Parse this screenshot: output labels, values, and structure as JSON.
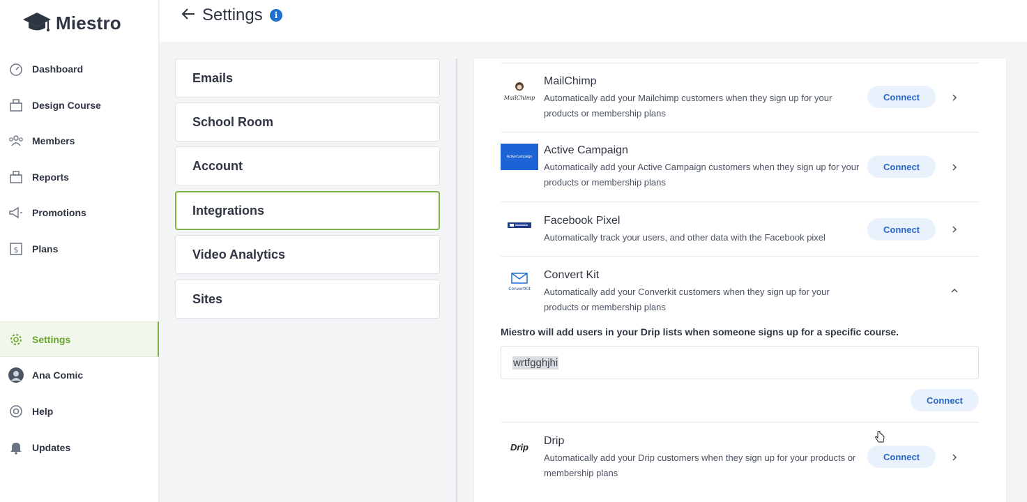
{
  "app": {
    "name": "Miestro"
  },
  "sidebar": {
    "items": [
      {
        "label": "Dashboard",
        "icon": "gauge-icon"
      },
      {
        "label": "Design Course",
        "icon": "box-icon"
      },
      {
        "label": "Members",
        "icon": "members-icon"
      },
      {
        "label": "Reports",
        "icon": "box-icon"
      },
      {
        "label": "Promotions",
        "icon": "megaphone-icon"
      },
      {
        "label": "Plans",
        "icon": "dollar-doc-icon"
      }
    ],
    "bottom_items": [
      {
        "label": "Settings",
        "icon": "gear-icon",
        "active": true
      },
      {
        "label": "Ana Comic",
        "icon": "avatar"
      },
      {
        "label": "Help",
        "icon": "lifebuoy-icon"
      },
      {
        "label": "Updates",
        "icon": "bell-icon"
      }
    ]
  },
  "header": {
    "title": "Settings",
    "info": "i"
  },
  "settings_menu": {
    "items": [
      "Emails",
      "School Room",
      "Account",
      "Integrations",
      "Video Analytics",
      "Sites"
    ],
    "active": "Integrations"
  },
  "integrations": {
    "items": [
      {
        "name": "MailChimp",
        "logo_text": "MailChimp",
        "desc": "Automatically add your Mailchimp customers when they sign up for your products or membership plans",
        "button": "Connect",
        "expanded": false
      },
      {
        "name": "Active Campaign",
        "logo_text": "ActiveCampaign",
        "desc": "Automatically add your Active Campaign customers when they sign up for your products or membership plans",
        "button": "Connect",
        "expanded": false
      },
      {
        "name": "Facebook Pixel",
        "logo_text": "",
        "desc": "Automatically track your users, and other data with the Facebook pixel",
        "button": "Connect",
        "expanded": false
      },
      {
        "name": "Convert Kit",
        "logo_text": "ConvertKit",
        "desc": "Automatically add your Converkit customers when they sign up for your products or membership plans",
        "button": "",
        "expanded": true
      },
      {
        "name": "Drip",
        "logo_text": "Drip",
        "desc": "Automatically add your Drip customers when they sign up for your products or membership plans",
        "button": "Connect",
        "expanded": false
      }
    ],
    "expanded_panel": {
      "note": "Miestro will add users in your Drip lists when someone signs up for a specific course.",
      "input_value": "wrtfgghjhi",
      "button": "Connect"
    }
  },
  "colors": {
    "accent_green": "#7cb342",
    "link_blue": "#2a66c6",
    "button_bg": "#e8f1fc",
    "activecampaign_blue": "#1e63d6"
  }
}
